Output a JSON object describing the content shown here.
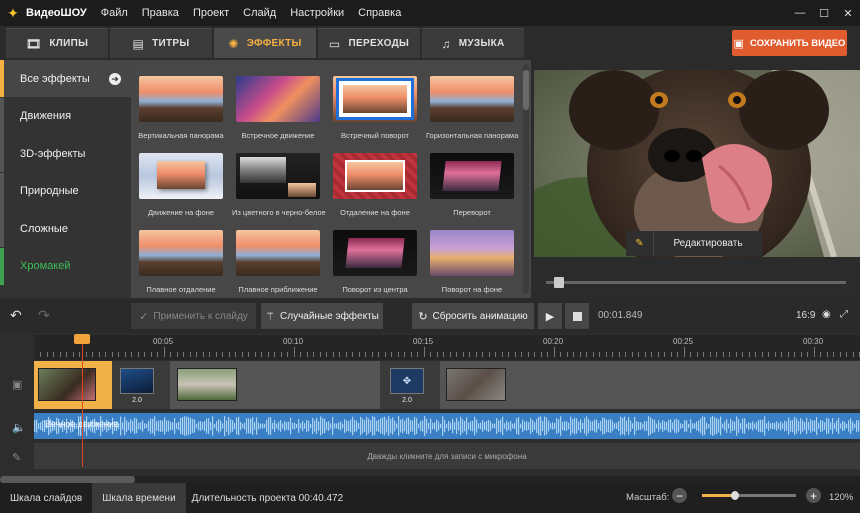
{
  "app": {
    "name": "ВидеоШОУ",
    "menu": [
      "Файл",
      "Правка",
      "Проект",
      "Слайд",
      "Настройки",
      "Справка"
    ]
  },
  "tabs": [
    {
      "label": "КЛИПЫ",
      "icon": "film-icon"
    },
    {
      "label": "ТИТРЫ",
      "icon": "titles-icon"
    },
    {
      "label": "ЭФФЕКТЫ",
      "icon": "effects-icon",
      "active": true
    },
    {
      "label": "ПЕРЕХОДЫ",
      "icon": "transitions-icon"
    },
    {
      "label": "МУЗЫКА",
      "icon": "music-icon"
    }
  ],
  "save_button": "СОХРАНИТЬ ВИДЕО",
  "categories": [
    {
      "label": "Все эффекты",
      "active": true
    },
    {
      "label": "Движения"
    },
    {
      "label": "3D-эффекты"
    },
    {
      "label": "Природные"
    },
    {
      "label": "Сложные"
    },
    {
      "label": "Хромакей",
      "green": true
    }
  ],
  "effects": [
    {
      "label": "Вертикальная панорама",
      "style": "pier"
    },
    {
      "label": "Встречное движение",
      "style": "pier-pink"
    },
    {
      "label": "Встречный поворот",
      "style": "framed-blue"
    },
    {
      "label": "Горизонтальная панорама",
      "style": "pier"
    },
    {
      "label": "Движение на фоне",
      "style": "float"
    },
    {
      "label": "Из цветного в черно-белое",
      "style": "bw"
    },
    {
      "label": "Отдаление на фоне",
      "style": "red-bg"
    },
    {
      "label": "Переворот",
      "style": "dark-flip"
    },
    {
      "label": "Плавное отдаление",
      "style": "pier"
    },
    {
      "label": "Плавное приближение",
      "style": "pier"
    },
    {
      "label": "Поворот из центра",
      "style": "dark-flip"
    },
    {
      "label": "Поворот на фоне",
      "style": "purple"
    }
  ],
  "preview": {
    "edit_button": "Редактировать"
  },
  "toolbar": {
    "apply": "Применить к слайду",
    "random": "Случайные эффекты",
    "reset": "Сбросить анимацию",
    "timecode": "00:01.849",
    "ratio": "16:9"
  },
  "timeline": {
    "ticks": [
      "00:05",
      "00:10",
      "00:15",
      "00:20",
      "00:25",
      "00:30"
    ],
    "transition_1": "2.0",
    "transition_2": "2.0",
    "audio_label": "Вечное движение",
    "mic_hint": "Дважды кликните для записи с микрофона"
  },
  "statusbar": {
    "tab_slides": "Шкала слайдов",
    "tab_timeline": "Шкала времени",
    "duration": "Длительность проекта 00:40.472",
    "zoom_label": "Масштаб:",
    "zoom_value": "120%",
    "zoom_fraction": 0.35
  }
}
